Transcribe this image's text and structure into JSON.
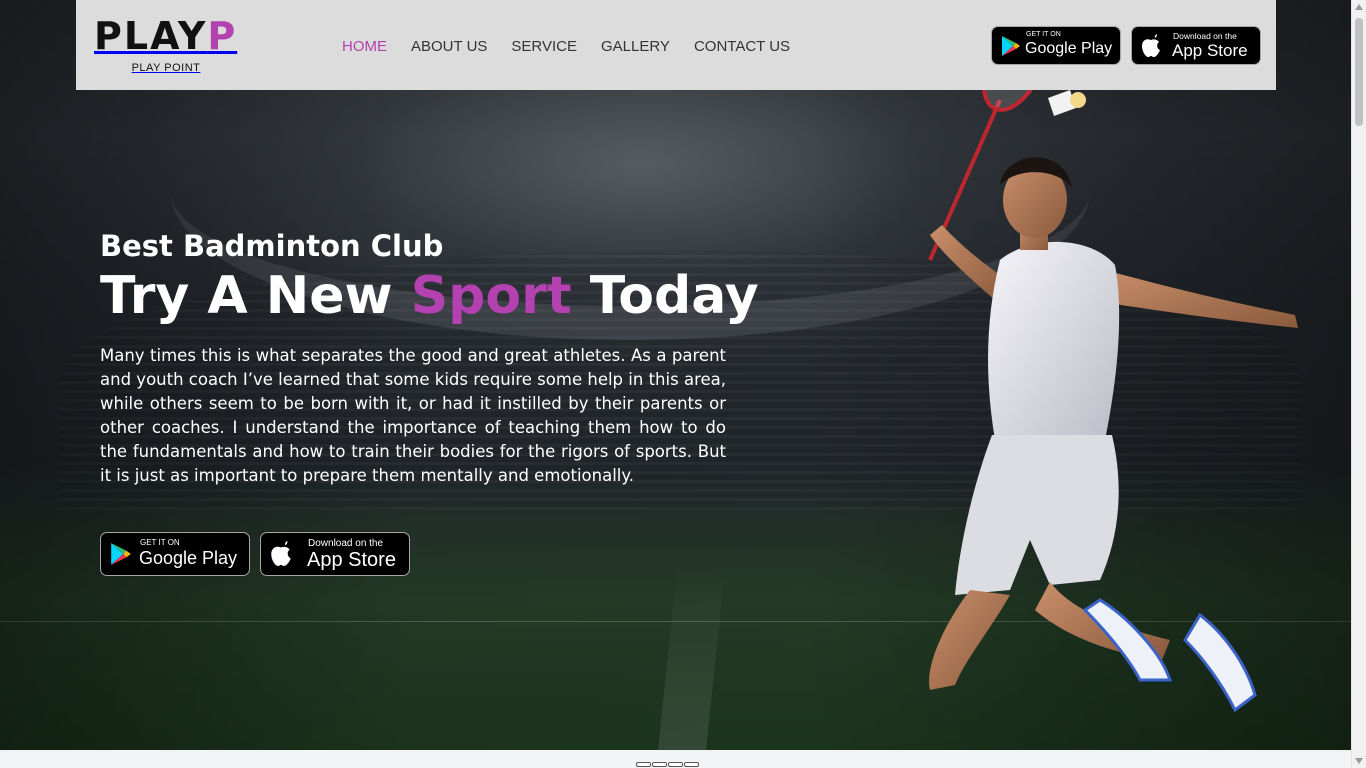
{
  "brand": {
    "name_main": "PLAY",
    "name_accent": "P",
    "tagline": "PLAY POINT",
    "accent_color": "#b441b0"
  },
  "nav": {
    "items": [
      {
        "label": "HOME",
        "active": true
      },
      {
        "label": "ABOUT US",
        "active": false
      },
      {
        "label": "SERVICE",
        "active": false
      },
      {
        "label": "GALLERY",
        "active": false
      },
      {
        "label": "CONTACT US",
        "active": false
      }
    ]
  },
  "badges": {
    "google_play": {
      "small": "GET IT ON",
      "big": "Google Play",
      "icon": "google-play-icon"
    },
    "app_store": {
      "small": "Download on the",
      "big": "App Store",
      "icon": "apple-icon"
    }
  },
  "hero": {
    "subtitle": "Best Badminton Club",
    "headline_pre": "Try A New ",
    "headline_accent": "Sport",
    "headline_post": " Today",
    "description": "Many times this is what separates the good and great athletes. As a parent and youth coach I’ve learned that some kids require some help in this area, while others seem to be born with it, or had it instilled by their parents or other coaches. I understand the importance of teaching them how to do the fundamentals and how to train their bodies for the rigors of sports. But it is just as important to prepare them mentally and emotionally."
  },
  "slider": {
    "dot_count": 4
  }
}
